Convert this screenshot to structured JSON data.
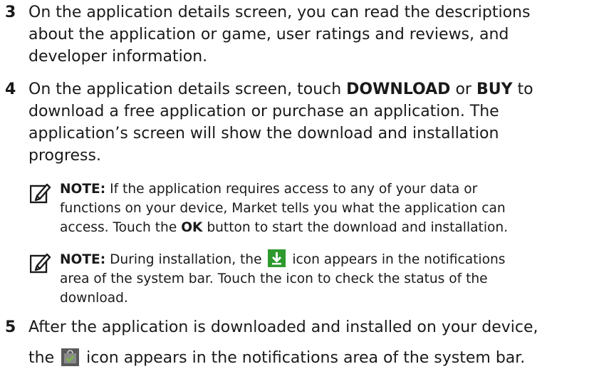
{
  "steps": [
    {
      "number": "3",
      "lines": [
        "On the application details screen, you can read the descriptions",
        "about the application or game, user ratings and reviews, and",
        "developer information."
      ]
    },
    {
      "number": "4",
      "line1_a": "On the application details screen, touch ",
      "line1_bold1": "DOWNLOAD",
      "line1_b": " or ",
      "line1_bold2": "BUY",
      "line1_c": " to",
      "lines_rest": [
        "download a free application or purchase an application. The",
        "application’s screen will show the download and installation",
        "progress."
      ]
    },
    {
      "number": "5",
      "line1": "After the application is downloaded and installed on your device,",
      "line2_a": "the ",
      "line2_b": " icon appears in the notifications area of the system bar."
    }
  ],
  "notes": [
    {
      "label": "NOTE:",
      "line1": " If the application requires access to any of your data or",
      "line2": "functions on your device, Market tells you what the application can",
      "line3_a": "access. Touch the ",
      "line3_bold": "OK",
      "line3_b": " button to start the download and installation."
    },
    {
      "label": "NOTE:",
      "line1_a": " During installation, the ",
      "line1_b": " icon appears in the notifications",
      "line2": "area of the system bar. Touch the icon to check the status of the",
      "line3": "download."
    }
  ],
  "icons": {
    "note": "pencil-note-icon",
    "download": "download-arrow-icon",
    "installed": "installed-bag-icon"
  },
  "colors": {
    "text": "#1a1a1a",
    "download_icon_bg": "#2e9a2e",
    "installed_icon_bg": "#5a5a5a",
    "installed_icon_check": "#7ab648"
  }
}
